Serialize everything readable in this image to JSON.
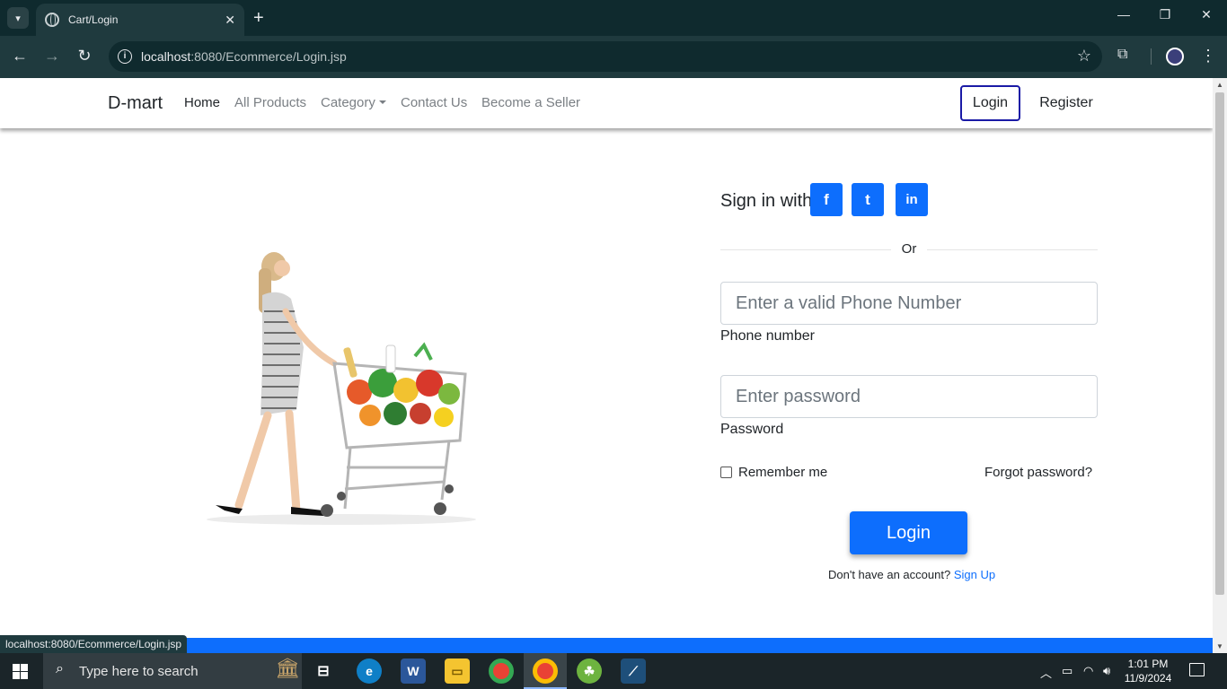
{
  "browser": {
    "tab_title": "Cart/Login",
    "url_host": "localhost",
    "url_path": ":8080/Ecommerce/Login.jsp",
    "status_url": "localhost:8080/Ecommerce/Login.jsp"
  },
  "navbar": {
    "brand": "D-mart",
    "links": [
      "Home",
      "All Products",
      "Category",
      "Contact Us",
      "Become a Seller"
    ],
    "login": "Login",
    "register": "Register"
  },
  "form": {
    "signin_text": "Sign in with",
    "social": [
      "f",
      "t",
      "in"
    ],
    "or_text": "Or",
    "phone_placeholder": "Enter a valid Phone Number",
    "phone_label": "Phone number",
    "password_placeholder": "Enter password",
    "password_label": "Password",
    "remember_label": "Remember me",
    "forgot_label": "Forgot password?",
    "login_button": "Login",
    "no_account_text": "Don't have an account?",
    "signup_link": "Sign Up"
  },
  "taskbar": {
    "search_placeholder": "Type here to search",
    "time": "1:01 PM",
    "date": "11/9/2024"
  },
  "colors": {
    "primary": "#0d6efd",
    "chrome_dark": "#0f2a2e",
    "nav_outline": "#1a1aa6"
  }
}
